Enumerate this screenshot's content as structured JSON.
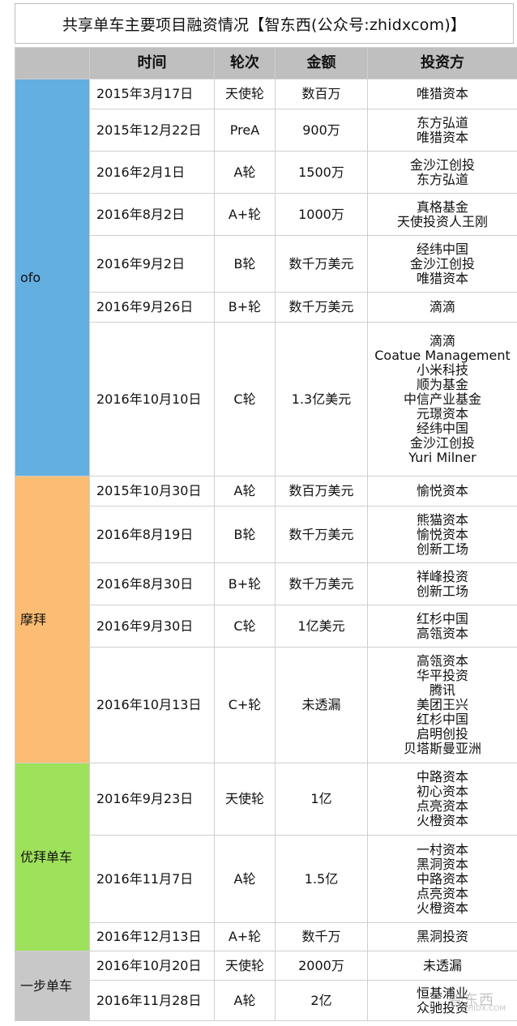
{
  "title": "共享单车主要项目融资情况【智东西(公众号:zhidxcom)】",
  "headers": [
    "时间",
    "轮次",
    "金额",
    "投资方"
  ],
  "colors": {
    "header": "#bfbfbf",
    "ofo": "#63afe0",
    "mobike": "#fbbd73",
    "ubike": "#9ee15b",
    "step": "#c8c8c8"
  },
  "companies": [
    {
      "name": "ofo",
      "color": "#63afe0",
      "rows": [
        {
          "date": "2015年3月17日",
          "round": "天使轮",
          "amount": "数百万",
          "investors": [
            "唯猎资本"
          ],
          "h": 37
        },
        {
          "date": "2015年12月22日",
          "round": "PreA",
          "amount": "900万",
          "investors": [
            "东方弘道",
            "唯猎资本"
          ],
          "h": 52
        },
        {
          "date": "2016年2月1日",
          "round": "A轮",
          "amount": "1500万",
          "investors": [
            "金沙江创投",
            "东方弘道"
          ],
          "h": 52
        },
        {
          "date": "2016年8月2日",
          "round": "A+轮",
          "amount": "1000万",
          "investors": [
            "真格基金",
            "天使投资人王刚"
          ],
          "h": 52
        },
        {
          "date": "2016年9月2日",
          "round": "B轮",
          "amount": "数千万美元",
          "investors": [
            "经纬中国",
            "金沙江创投",
            "唯猎资本"
          ],
          "h": 70
        },
        {
          "date": "2016年9月26日",
          "round": "B+轮",
          "amount": "数千万美元",
          "investors": [
            "滴滴"
          ],
          "h": 37
        },
        {
          "date": "2016年10月10日",
          "round": "C轮",
          "amount": "1.3亿美元",
          "investors": [
            "滴滴",
            "Coatue Management",
            "小米科技",
            "顺为基金",
            "中信产业基金",
            "元璟资本",
            "经纬中国",
            "金沙江创投",
            "Yuri Milner"
          ],
          "h": 190
        }
      ]
    },
    {
      "name": "摩拜",
      "color": "#fbbd73",
      "rows": [
        {
          "date": "2015年10月30日",
          "round": "A轮",
          "amount": "数百万美元",
          "investors": [
            "愉悦资本"
          ],
          "h": 37
        },
        {
          "date": "2016年8月19日",
          "round": "B轮",
          "amount": "数千万美元",
          "investors": [
            "熊猫资本",
            "愉悦资本",
            "创新工场"
          ],
          "h": 70
        },
        {
          "date": "2016年8月30日",
          "round": "B+轮",
          "amount": "数千万美元",
          "investors": [
            "祥峰投资",
            "创新工场"
          ],
          "h": 52
        },
        {
          "date": "2016年9月30日",
          "round": "C轮",
          "amount": "1亿美元",
          "investors": [
            "红杉中国",
            "高瓴资本"
          ],
          "h": 52
        },
        {
          "date": "2016年10月13日",
          "round": "C+轮",
          "amount": "未透漏",
          "investors": [
            "高瓴资本",
            "华平投资",
            "腾讯",
            "美团王兴",
            "红杉中国",
            "启明创投",
            "贝塔斯曼亚洲"
          ],
          "h": 143
        }
      ]
    },
    {
      "name": "优拜单车",
      "color": "#9ee15b",
      "rows": [
        {
          "date": "2016年9月23日",
          "round": "天使轮",
          "amount": "1亿",
          "investors": [
            "中路资本",
            "初心资本",
            "点亮资本",
            "火橙资本"
          ],
          "h": 89
        },
        {
          "date": "2016年11月7日",
          "round": "A轮",
          "amount": "1.5亿",
          "investors": [
            "一村资本",
            "黑洞资本",
            "中路资本",
            "点亮资本",
            "火橙资本"
          ],
          "h": 108
        },
        {
          "date": "2016年12月13日",
          "round": "A+轮",
          "amount": "数千万",
          "investors": [
            "黑洞投资"
          ],
          "h": 35
        }
      ]
    },
    {
      "name": "一步单车",
      "color": "#c8c8c8",
      "rows": [
        {
          "date": "2016年10月20日",
          "round": "天使轮",
          "amount": "2000万",
          "investors": [
            "未透漏"
          ],
          "h": 36
        },
        {
          "date": "2016年11月28日",
          "round": "A轮",
          "amount": "2亿",
          "investors": [
            "恒基浦业",
            "众驰投资"
          ],
          "h": 50
        }
      ]
    }
  ],
  "watermark": {
    "text": "智东西",
    "sub": "ZHIDX.COM"
  }
}
